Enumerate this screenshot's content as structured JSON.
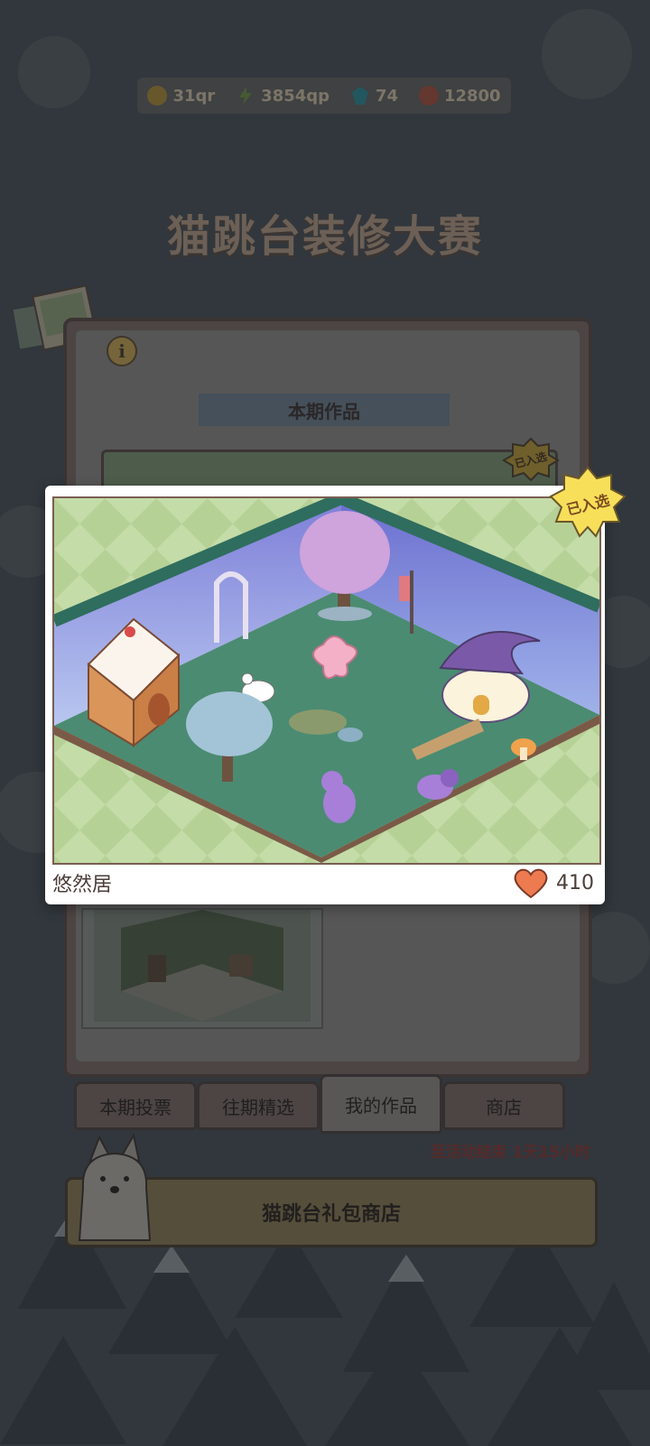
{
  "currency": [
    {
      "icon": "coin-icon",
      "value": "31qr",
      "color": "#d6a83a"
    },
    {
      "icon": "lightning-icon",
      "value": "3854qp",
      "color": "#7fb04b"
    },
    {
      "icon": "gem-icon",
      "value": "74",
      "color": "#3fb6c2"
    },
    {
      "icon": "token-icon",
      "value": "12800",
      "color": "#e06a50"
    }
  ],
  "event_title": "猫跳台装修大赛",
  "section_header": "本期作品",
  "badge_small": "已入选",
  "popup": {
    "badge": "已入选",
    "entry_name": "悠然居",
    "likes": "410"
  },
  "tabs": [
    {
      "label": "本期投票",
      "active": false
    },
    {
      "label": "往期精选",
      "active": false
    },
    {
      "label": "我的作品",
      "active": true
    },
    {
      "label": "商店",
      "active": false
    }
  ],
  "countdown": "至活动结束 1天15小时",
  "gift_shop": "猫跳台礼包商店"
}
